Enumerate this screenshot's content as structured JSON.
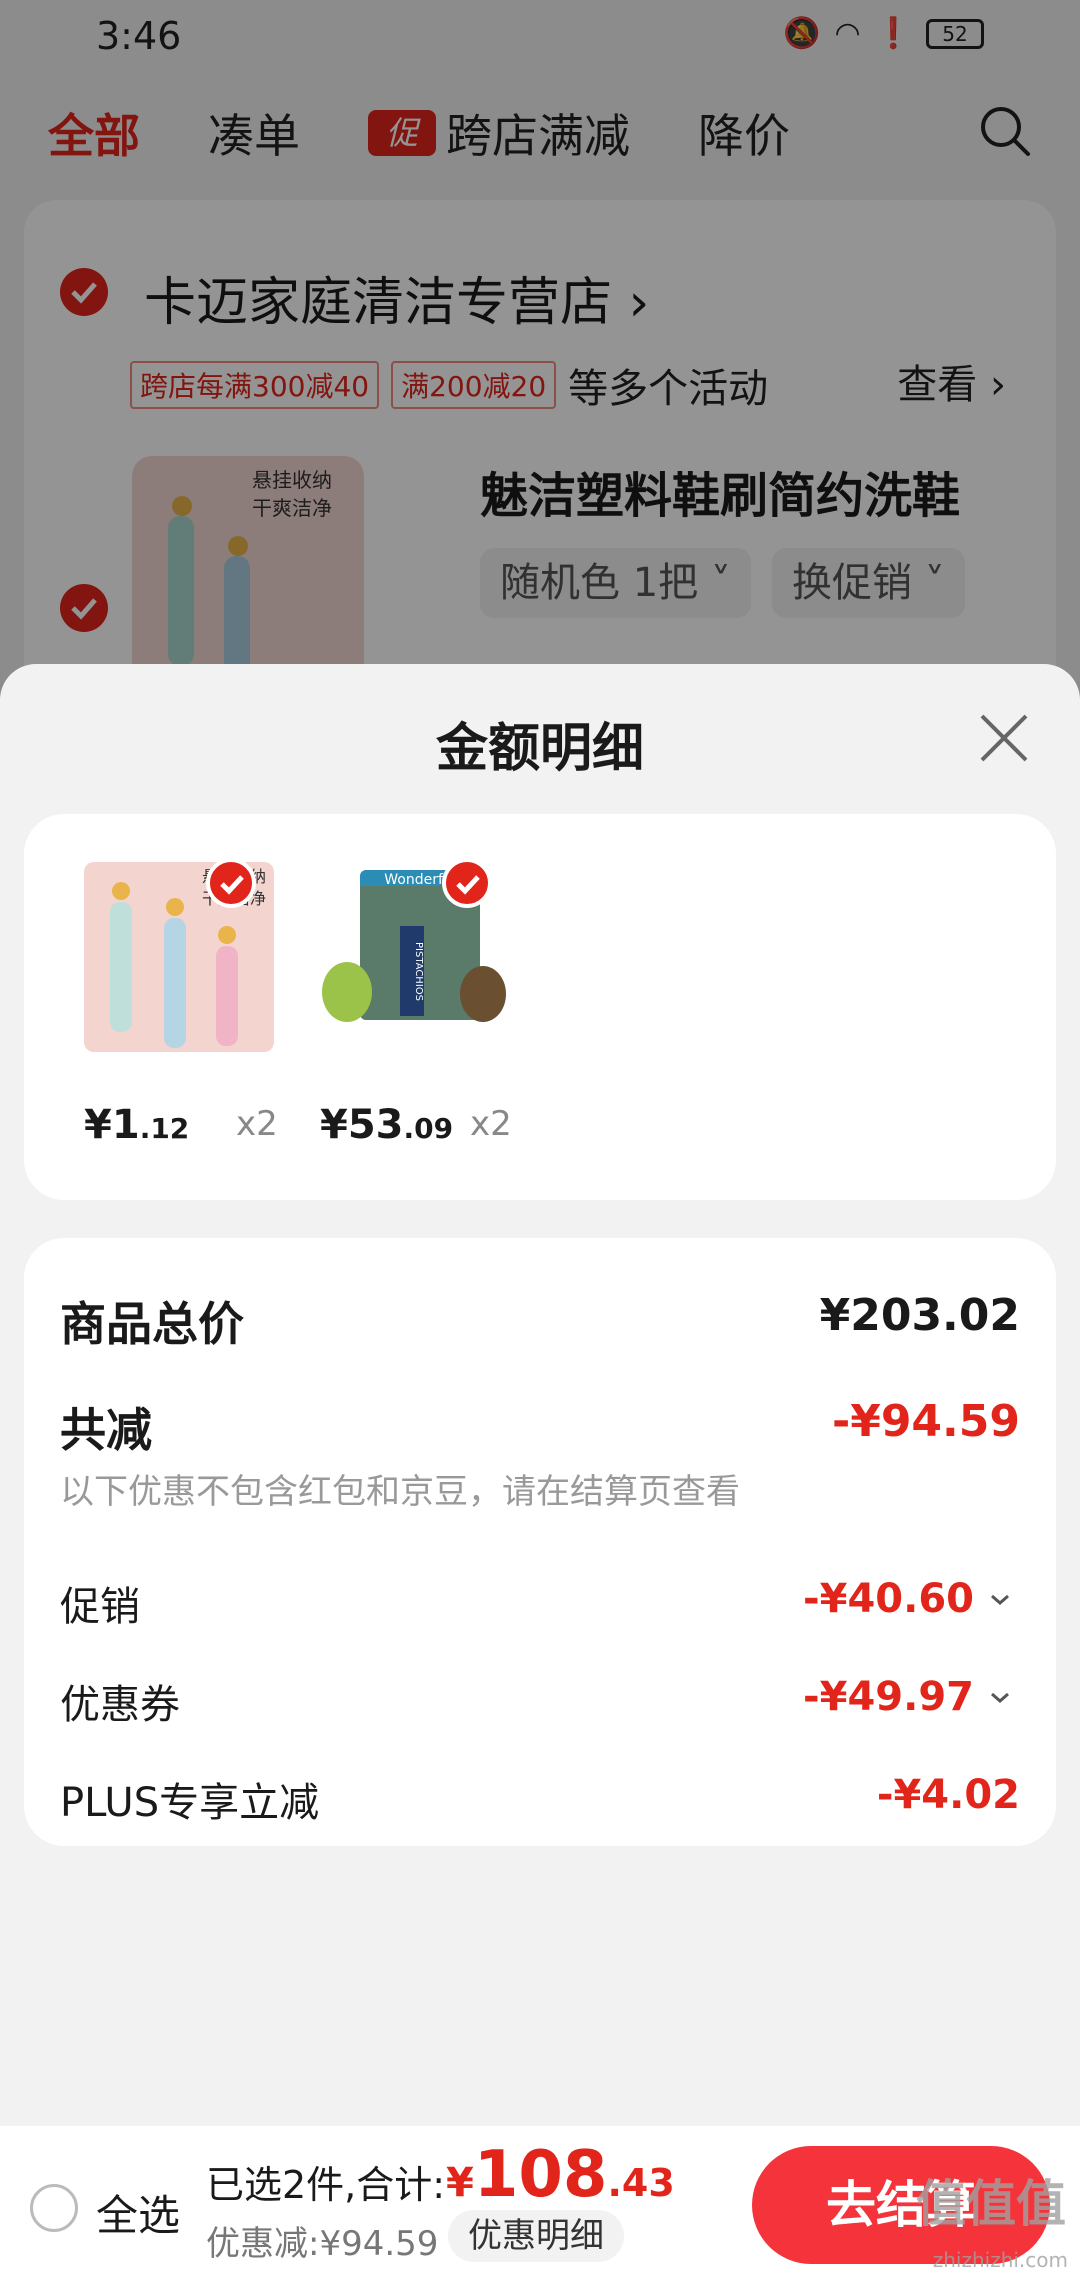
{
  "status_bar": {
    "time": "3:46",
    "battery": "52"
  },
  "filter_tabs": [
    {
      "label": "全部",
      "active": true
    },
    {
      "label": "凑单"
    },
    {
      "label": "跨店满减",
      "badge": "促"
    },
    {
      "label": "降价"
    }
  ],
  "store": {
    "name": "卡迈家庭清洁专营店",
    "promo_tags": [
      "跨店每满300减40",
      "满200减20"
    ],
    "promo_more": "等多个活动",
    "view_label": "查看",
    "product": {
      "title": "魅洁塑料鞋刷简约洗鞋",
      "spec": "随机色 1把",
      "promo_switch": "换促销",
      "image_text": [
        "悬挂收纳",
        "干爽洁净"
      ]
    }
  },
  "sheet": {
    "title": "金额明细",
    "items": [
      {
        "price_currency": "¥",
        "price_int": "1",
        "price_dec": ".12",
        "qty": "x2",
        "image_text": [
          "悬挂收纳",
          "干爽洁净"
        ]
      },
      {
        "price_currency": "¥",
        "price_int": "53",
        "price_dec": ".09",
        "qty": "x2",
        "image_text": [
          "Wonderful",
          "PISTACHIOS"
        ]
      }
    ],
    "summary": {
      "total_label": "商品总价",
      "total_value": "¥203.02",
      "reduce_label": "共减",
      "reduce_value": "-¥94.59",
      "note": "以下优惠不包含红包和京豆，请在结算页查看",
      "rows": [
        {
          "label": "促销",
          "value": "-¥40.60",
          "expandable": true
        },
        {
          "label": "优惠券",
          "value": "-¥49.97",
          "expandable": true
        },
        {
          "label": "PLUS专享立减",
          "value": "-¥4.02",
          "expandable": false
        }
      ]
    }
  },
  "bottom_bar": {
    "select_all": "全选",
    "selected_text": "已选2件,合计:",
    "total_currency": "¥",
    "total_int": "108",
    "total_dec": ".43",
    "discount_text": "优惠减:¥94.59",
    "detail_label": "优惠明细",
    "checkout_label": "去结算"
  },
  "watermark": {
    "text": "值值值",
    "sub": "zhizhizhi.com"
  },
  "colors": {
    "accent": "#e1251b",
    "checkout": "#f5333a"
  }
}
